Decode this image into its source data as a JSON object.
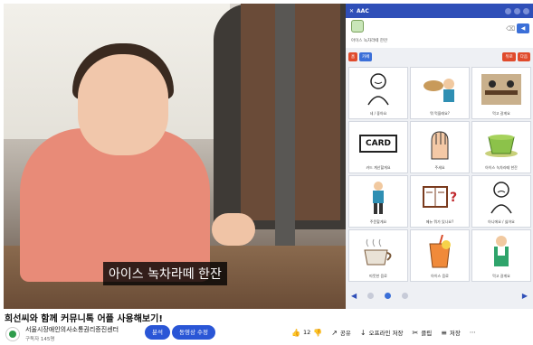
{
  "video": {
    "caption": "아이스 녹차라떼 한잔"
  },
  "app": {
    "title": "AAC",
    "sentence_text": "아이스 녹차라떼 한잔",
    "toolbar": {
      "home": "홈",
      "category": "카페",
      "back": "뒤로",
      "next": "다음"
    },
    "cards": [
      {
        "label": "네 / 좋아요",
        "icon": "yes-person-icon"
      },
      {
        "label": "뭐 먹을래요?",
        "icon": "eating-icon"
      },
      {
        "label": "먹고 갈게요",
        "icon": "cafe-table-icon"
      },
      {
        "label": "카드 계산할게요",
        "word": "CARD"
      },
      {
        "label": "주세요",
        "icon": "hand-icon"
      },
      {
        "label": "아이스 녹차라떼 한잔",
        "icon": "green-tea-icon"
      },
      {
        "label": "주문할게요",
        "icon": "order-person-icon"
      },
      {
        "label": "메뉴 뭐가 있나요?",
        "icon": "menu-icon"
      },
      {
        "label": "아니에요 / 싫어요",
        "icon": "no-person-icon"
      },
      {
        "label": "따뜻한 음료",
        "icon": "hot-drink-icon"
      },
      {
        "label": "아이스 음료",
        "icon": "iced-drink-icon"
      },
      {
        "label": "먹고 갈게요",
        "icon": "waiter-icon"
      }
    ],
    "pager": {
      "current": 2,
      "total": 3
    }
  },
  "page": {
    "title": "희선씨와 함께 커뮤니톡 어플 사용해보기!",
    "channel_name": "서울시장애인의사소통권리증진센터",
    "channel_subs": "구독자 145명",
    "subscribe_label": "분석",
    "edit_label": "동영상 수정",
    "like_count": "12",
    "share_label": "공유",
    "offline_label": "오프라인 저장",
    "clip_label": "클립",
    "save_label": "저장",
    "more_label": "⋯"
  }
}
